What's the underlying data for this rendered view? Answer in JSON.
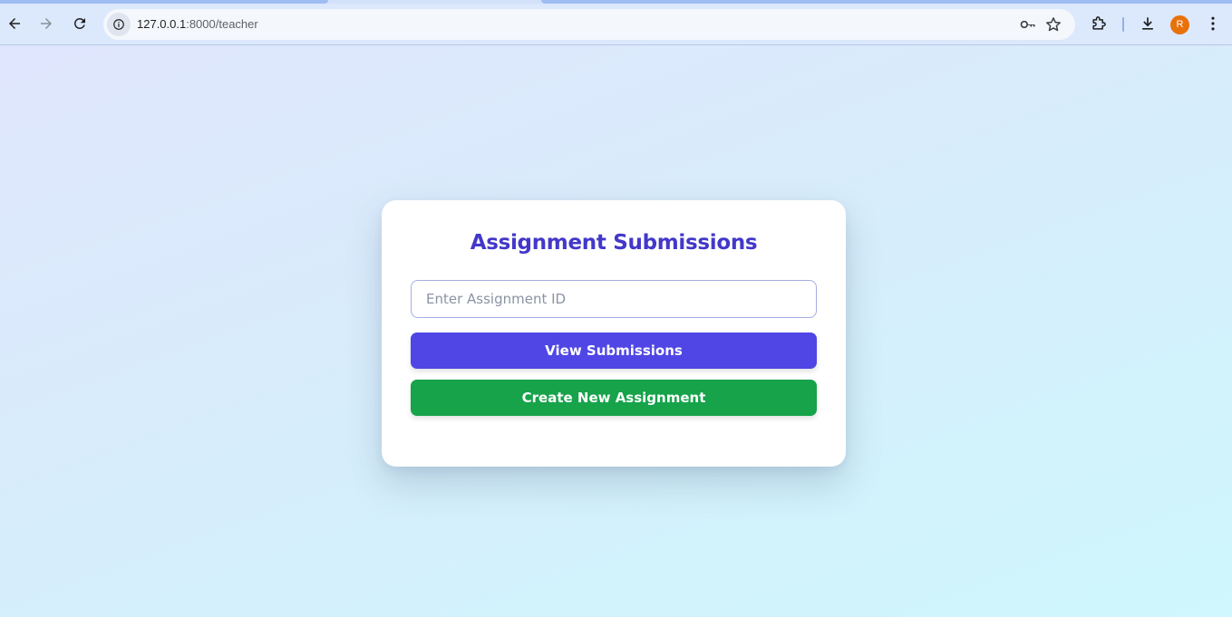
{
  "browser": {
    "url_host": "127.0.0.1",
    "url_path": ":8000/teacher",
    "avatar_initial": "R",
    "icons": {
      "back": "arrow-left-icon",
      "forward": "arrow-right-icon",
      "reload": "reload-icon",
      "site_info": "info-icon",
      "password": "key-icon",
      "bookmark": "star-icon",
      "extensions": "puzzle-icon",
      "downloads": "download-icon",
      "menu": "kebab-menu-icon"
    },
    "colors": {
      "avatar": "#e8710a"
    }
  },
  "page": {
    "title": "Assignment Submissions",
    "assignment_id_input": {
      "value": "",
      "placeholder": "Enter Assignment ID"
    },
    "view_button_label": "View Submissions",
    "create_button_label": "Create New Assignment",
    "colors": {
      "title": "#4338ca",
      "view_button": "#4f46e5",
      "create_button": "#16a34a"
    }
  }
}
